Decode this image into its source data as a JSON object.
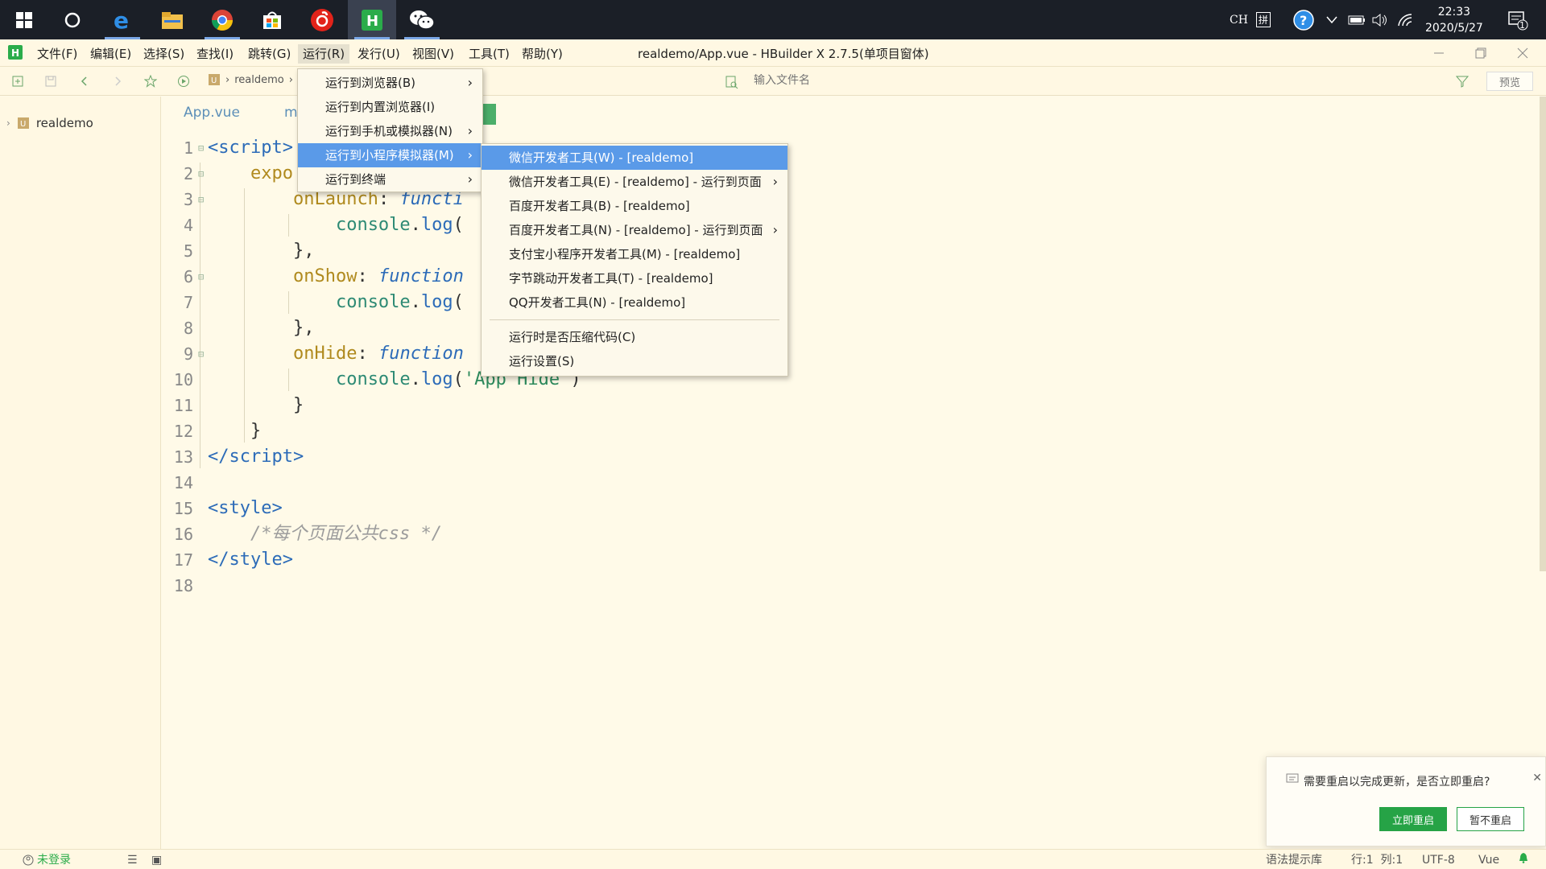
{
  "taskbar": {
    "icons": [
      "windows-start-icon",
      "search-circle-icon",
      "edge-icon",
      "file-explorer-icon",
      "chrome-icon",
      "store-icon",
      "netease-music-icon",
      "hbuilder-icon",
      "wechat-icon"
    ],
    "input_method": "CH",
    "ime_mode": "拼",
    "time": "22:33",
    "date": "2020/5/27",
    "notification_count": "1"
  },
  "menubar": {
    "items": [
      "文件(F)",
      "编辑(E)",
      "选择(S)",
      "查找(I)",
      "跳转(G)",
      "运行(R)",
      "发行(U)",
      "视图(V)",
      "工具(T)",
      "帮助(Y)"
    ],
    "window_title": "realdemo/App.vue - HBuilder X 2.7.5(单项目窗体)"
  },
  "toolbar": {
    "breadcrumb_project": "realdemo",
    "file_search_placeholder": "输入文件名",
    "preview_label": "预览"
  },
  "project": {
    "root": "realdemo"
  },
  "editor": {
    "tabs": [
      "App.vue",
      "m"
    ],
    "line_numbers": [
      "1",
      "2",
      "3",
      "4",
      "5",
      "6",
      "7",
      "8",
      "9",
      "10",
      "11",
      "12",
      "13",
      "14",
      "15",
      "16",
      "17",
      "18"
    ]
  },
  "run_menu": {
    "items": [
      {
        "label": "运行到浏览器(B)"
      },
      {
        "label": "运行到内置浏览器(I)"
      },
      {
        "label": "运行到手机或模拟器(N)"
      },
      {
        "label": "运行到小程序模拟器(M)"
      },
      {
        "label": "运行到终端"
      }
    ]
  },
  "miniprogram_menu": {
    "items": [
      {
        "label": "微信开发者工具(W) - [realdemo]"
      },
      {
        "label": "微信开发者工具(E) - [realdemo] - 运行到页面"
      },
      {
        "label": "百度开发者工具(B) - [realdemo]"
      },
      {
        "label": "百度开发者工具(N) - [realdemo] - 运行到页面"
      },
      {
        "label": "支付宝小程序开发者工具(M) - [realdemo]"
      },
      {
        "label": "字节跳动开发者工具(T) - [realdemo]"
      },
      {
        "label": "QQ开发者工具(N) - [realdemo]"
      },
      {
        "label": "运行时是否压缩代码(C)"
      },
      {
        "label": "运行设置(S)"
      }
    ]
  },
  "notification": {
    "message": "需要重启以完成更新，是否立即重启?",
    "restart_label": "立即重启",
    "later_label": "暂不重启"
  },
  "statusbar": {
    "login": "未登录",
    "syntax_hint": "语法提示库",
    "position": "行:1  列:1",
    "encoding": "UTF-8",
    "language": "Vue"
  },
  "colors": {
    "accent_green": "#26a346",
    "menu_highlight": "#5a9ae8",
    "editor_bg": "#fffae8"
  }
}
